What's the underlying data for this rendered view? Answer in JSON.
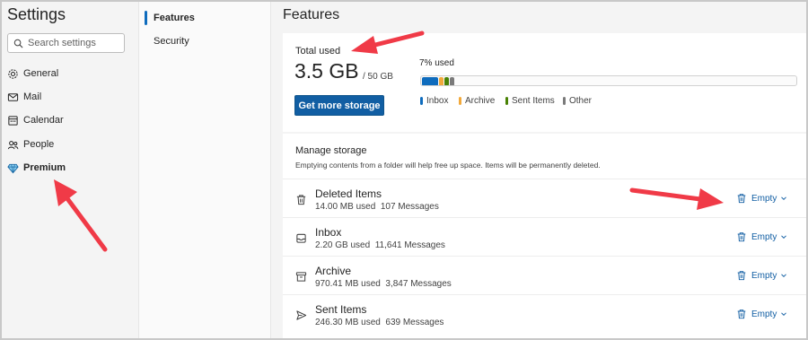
{
  "sidebar": {
    "title": "Settings",
    "search_placeholder": "Search settings",
    "items": [
      {
        "label": "General",
        "icon": "gear-icon"
      },
      {
        "label": "Mail",
        "icon": "mail-icon"
      },
      {
        "label": "Calendar",
        "icon": "calendar-icon"
      },
      {
        "label": "People",
        "icon": "people-icon"
      },
      {
        "label": "Premium",
        "icon": "diamond-icon"
      }
    ]
  },
  "subnav": {
    "items": [
      {
        "label": "Features",
        "active": true
      },
      {
        "label": "Security",
        "active": false
      }
    ]
  },
  "main": {
    "title": "Features",
    "storage": {
      "total_label": "Total used",
      "total_value": "3.5 GB",
      "total_max": "/ 50 GB",
      "button_label": "Get more storage",
      "percent_label": "7% used",
      "segments": [
        {
          "name": "Inbox",
          "color": "#0f6cbd",
          "fraction": 0.044
        },
        {
          "name": "Archive",
          "color": "#f2a93b",
          "fraction": 0.011
        },
        {
          "name": "Sent Items",
          "color": "#498205",
          "fraction": 0.011
        },
        {
          "name": "Other",
          "color": "#7a7a7a",
          "fraction": 0.011
        }
      ],
      "legend": [
        "Inbox",
        "Archive",
        "Sent Items",
        "Other"
      ]
    },
    "manage": {
      "title": "Manage storage",
      "description": "Emptying contents from a folder will help free up space. Items will be permanently deleted.",
      "empty_label": "Empty",
      "folders": [
        {
          "name": "Deleted Items",
          "size": "14.00 MB used",
          "messages": "107 Messages",
          "icon": "trash-icon"
        },
        {
          "name": "Inbox",
          "size": "2.20 GB used",
          "messages": "11,641 Messages",
          "icon": "inbox-icon"
        },
        {
          "name": "Archive",
          "size": "970.41 MB used",
          "messages": "3,847 Messages",
          "icon": "archive-icon"
        },
        {
          "name": "Sent Items",
          "size": "246.30 MB used",
          "messages": "639 Messages",
          "icon": "send-icon"
        }
      ]
    }
  },
  "colors": {
    "accent": "#0f6cbd",
    "button_bg": "#115ea3",
    "annotation_arrow": "#f03a47"
  }
}
